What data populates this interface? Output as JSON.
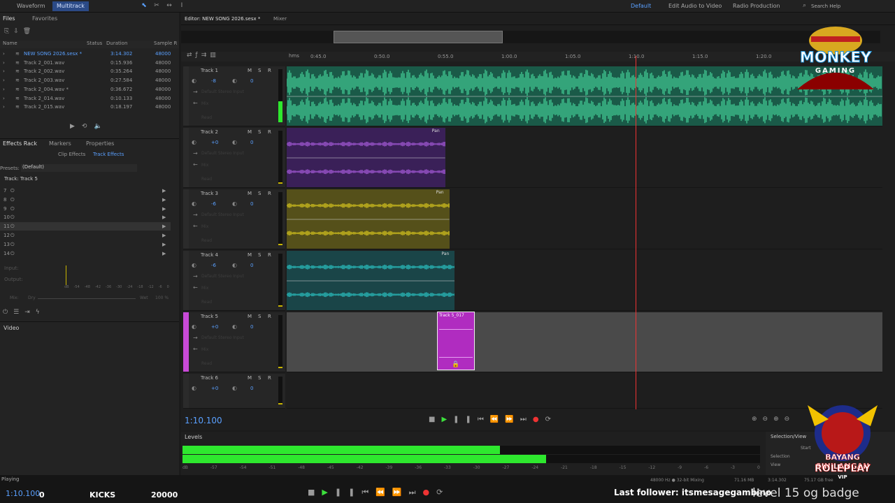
{
  "topbar": {
    "tabs": [
      "Waveform",
      "Multitrack"
    ],
    "workspaces": [
      "Default",
      "Edit Audio to Video",
      "Radio Production"
    ],
    "search_placeholder": "Search Help"
  },
  "files_panel": {
    "tabs": [
      "Files",
      "Favorites"
    ],
    "columns": [
      "Name",
      "Status",
      "Duration",
      "Sample R"
    ],
    "rows": [
      {
        "name": "NEW SONG 2026.sesx *",
        "duration": "3:14.302",
        "rate": "48000"
      },
      {
        "name": "Track 2_001.wav",
        "duration": "0:15.936",
        "rate": "48000"
      },
      {
        "name": "Track 2_002.wav",
        "duration": "0:35.264",
        "rate": "48000"
      },
      {
        "name": "Track 2_003.wav",
        "duration": "0:27.584",
        "rate": "48000"
      },
      {
        "name": "Track 2_004.wav *",
        "duration": "0:36.672",
        "rate": "48000"
      },
      {
        "name": "Track 2_014.wav",
        "duration": "0:10.133",
        "rate": "48000"
      },
      {
        "name": "Track 2_015.wav",
        "duration": "0:18.197",
        "rate": "48000"
      }
    ]
  },
  "effects_panel": {
    "tabs": [
      "Effects Rack",
      "Markers",
      "Properties"
    ],
    "subtabs": [
      "Clip Effects",
      "Track Effects"
    ],
    "presets_label": "Presets:",
    "presets_value": "(Default)",
    "track_label": "Track: Track 5",
    "slots": [
      "7",
      "8",
      "9",
      "10",
      "11",
      "12",
      "13",
      "14"
    ],
    "input_label": "Input:",
    "output_label": "Output:",
    "mix_label": "Mix:",
    "dry_label": "Dry",
    "wet_label": "Wet",
    "pct_label": "100 %",
    "meter_scale": [
      "dB",
      "-54",
      "-48",
      "-42",
      "-36",
      "-30",
      "-24",
      "-18",
      "-12",
      "-6",
      "0"
    ]
  },
  "video_label": "Video",
  "editor": {
    "tabs": [
      "Editor: NEW SONG 2026.sesx *",
      "Mixer"
    ],
    "ruler_unit": "hms",
    "ruler_ticks": [
      "0:45.0",
      "0:50.0",
      "0:55.0",
      "1:00.0",
      "1:05.0",
      "1:10.0",
      "1:15.0",
      "1:20.0"
    ],
    "tracks": [
      {
        "name": "Track 1",
        "vol": "-8",
        "pan": "0",
        "color": "#3fc490",
        "clip_end_pct": 100,
        "dark": "#1a5a48"
      },
      {
        "name": "Track 2",
        "vol": "+0",
        "pan": "0",
        "color": "#a55ad8",
        "clip_end_pct": 26.6,
        "dark": "#3a2058"
      },
      {
        "name": "Track 3",
        "vol": "-6",
        "pan": "0",
        "color": "#d4c21e",
        "clip_end_pct": 27.3,
        "dark": "#55501a"
      },
      {
        "name": "Track 4",
        "vol": "-6",
        "pan": "0",
        "color": "#2ac0c0",
        "clip_end_pct": 28.2,
        "dark": "#1a4548"
      },
      {
        "name": "Track 5",
        "vol": "+0",
        "pan": "0",
        "color": "#c84ad8",
        "clip_end_pct": 0,
        "dark": "#555"
      },
      {
        "name": "Track 6",
        "vol": "+0",
        "pan": "0",
        "color": "#777",
        "clip_end_pct": 0,
        "dark": "#1e1e1e"
      }
    ],
    "track_ctrl_labels": {
      "m": "M",
      "s": "S",
      "r": "R",
      "input": "Default Stereo Input",
      "fx": "Mix",
      "read": "Read"
    },
    "pan_label": "Pan",
    "small_clip_label": "Track 5_017",
    "time_display": "1:10.100"
  },
  "levels": {
    "title": "Levels",
    "scale": [
      "dB",
      "-57",
      "-54",
      "-51",
      "-48",
      "-45",
      "-42",
      "-39",
      "-36",
      "-33",
      "-30",
      "-27",
      "-24",
      "-21",
      "-18",
      "-15",
      "-12",
      "-9",
      "-6",
      "-3",
      "0"
    ],
    "left_pct": 55.0,
    "right_pct": 63.0
  },
  "selection_view": {
    "title": "Selection/View",
    "rows": [
      "Start",
      "Selection",
      "View"
    ]
  },
  "status": {
    "state": "Playing",
    "time": "1:10.100",
    "col0": "0",
    "kicks": "KICKS",
    "num": "20000",
    "format": "48000 Hz ● 32-bit Mixing",
    "mem": "71.16 MB",
    "dur": "3:14.302",
    "free": "75.17 GB free",
    "follower": "Last follower: itsmesagegambino",
    "level": "level 15 og badge"
  },
  "overlays": {
    "top_logo": {
      "line1": "MONKEY",
      "line2": "GAMING",
      "color": "#1a8fd6"
    },
    "bottom_logo": {
      "line1": "BAYANG SINILANGAN",
      "line2": "ROLEPLAY",
      "line3": "VIP"
    }
  },
  "colors": {
    "accent": "#2b4a86",
    "playhead": "#e33333",
    "meter_green": "#2ee82e"
  }
}
